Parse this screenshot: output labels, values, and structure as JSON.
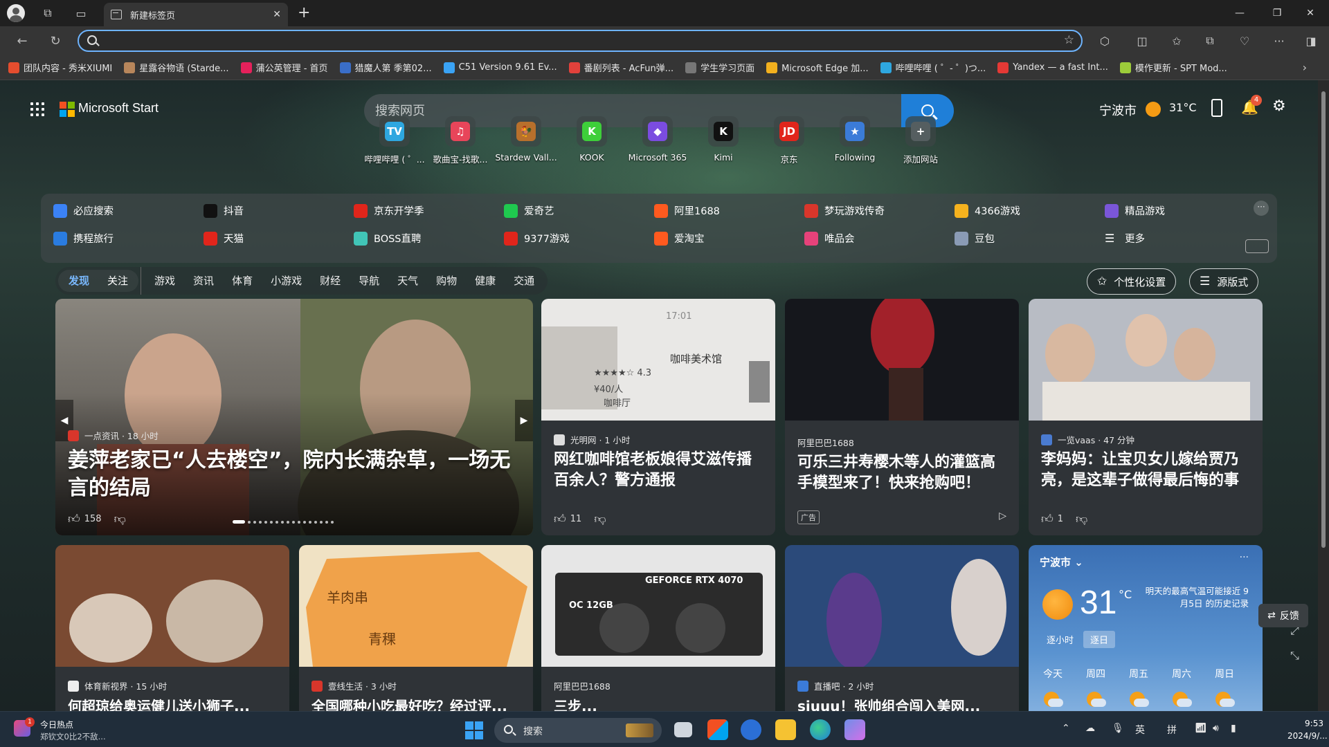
{
  "browser": {
    "tab_title": "新建标签页",
    "address_value": "",
    "favorites": [
      {
        "label": "团队内容 - 秀米XIUMI",
        "color": "#e54d2e"
      },
      {
        "label": "星露谷物语 (Starde...",
        "color": "#b8865b"
      },
      {
        "label": "蒲公英管理 - 首页",
        "color": "#e5215b"
      },
      {
        "label": "猎魔人第 季第02...",
        "color": "#3a6ec8"
      },
      {
        "label": "C51 Version 9.61 Ev...",
        "color": "#3aa3f5"
      },
      {
        "label": "番剧列表 - AcFun弹...",
        "color": "#e2413b"
      },
      {
        "label": "学生学习页面",
        "color": "#777777"
      },
      {
        "label": "Microsoft Edge 加...",
        "color": "#f2b01e"
      },
      {
        "label": "哔哩哔哩 ( ゜- ゜)つ...",
        "color": "#2ea7e0"
      },
      {
        "label": "Yandex — a fast Int...",
        "color": "#e53935"
      },
      {
        "label": "模作更新 - SPT Mod...",
        "color": "#9ccc3a"
      }
    ]
  },
  "header": {
    "brand": "Microsoft Start",
    "search_placeholder": "搜索网页",
    "city": "宁波市",
    "temp": "31°C",
    "notif_count": "4"
  },
  "quick_links": [
    {
      "label": "哔哩哔哩 ( ゜...",
      "glyph": "TV",
      "color": "#2ea7e0"
    },
    {
      "label": "歌曲宝-找歌...",
      "glyph": "♫",
      "color": "#e8455a"
    },
    {
      "label": "Stardew Vall...",
      "glyph": "🐓",
      "color": "#b8702c"
    },
    {
      "label": "KOOK",
      "glyph": "K",
      "color": "#3ecf3a"
    },
    {
      "label": "Microsoft 365",
      "glyph": "◆",
      "color": "#7b4ce0"
    },
    {
      "label": "Kimi",
      "glyph": "K",
      "color": "#111111"
    },
    {
      "label": "京东",
      "glyph": "JD",
      "color": "#e1251b"
    },
    {
      "label": "Following",
      "glyph": "★",
      "color": "#3b7bd8"
    },
    {
      "label": "添加网站",
      "glyph": "+",
      "color": "#555e60"
    }
  ],
  "link_panel": {
    "row1": [
      {
        "label": "必应搜索",
        "color": "#3b82f6"
      },
      {
        "label": "抖音",
        "color": "#111111"
      },
      {
        "label": "京东开学季",
        "color": "#e1251b"
      },
      {
        "label": "爱奇艺",
        "color": "#1fc94f"
      },
      {
        "label": "阿里1688",
        "color": "#ff5a1f"
      },
      {
        "label": "梦玩游戏传奇",
        "color": "#d9362b"
      },
      {
        "label": "4366游戏",
        "color": "#f5b21e"
      },
      {
        "label": "精品游戏",
        "color": "#7a56d8"
      }
    ],
    "row2": [
      {
        "label": "携程旅行",
        "color": "#2a7ce0"
      },
      {
        "label": "天猫",
        "color": "#e1251b"
      },
      {
        "label": "BOSS直聘",
        "color": "#41c5b7"
      },
      {
        "label": "9377游戏",
        "color": "#e1251b"
      },
      {
        "label": "爱淘宝",
        "color": "#ff5a1f"
      },
      {
        "label": "唯品会",
        "color": "#e6427a"
      },
      {
        "label": "豆包",
        "color": "#8a9bb5"
      },
      {
        "label": "更多",
        "color": "transparent"
      }
    ]
  },
  "nav": {
    "tabs": [
      "发现",
      "关注",
      "游戏",
      "资讯",
      "体育",
      "小游戏",
      "财经",
      "导航",
      "天气",
      "购物",
      "健康",
      "交通"
    ],
    "personalize": "个性化设置",
    "layout": "源版式"
  },
  "cards": {
    "hero": {
      "source": "一点资讯 · 18 小时",
      "title": "姜萍老家已“人去楼空”，院内长满杂草，一场无言的结局",
      "likes": "158"
    },
    "c2": {
      "source": "光明网 · 1 小时",
      "title": "网红咖啡馆老板娘得艾滋传播百余人？警方通报",
      "likes": "11",
      "img_time": "17:01",
      "img_shop": "咖啡美术馆",
      "img_rating": "★★★★☆ 4.3",
      "img_price": "¥40/人",
      "img_type": "咖啡厅"
    },
    "c3": {
      "source": "阿里巴巴1688",
      "title": "可乐三井寿樱木等人的灌篮高手模型来了！快来抢购吧！",
      "ad": "广告"
    },
    "c4": {
      "source": "一览vaas · 47 分钟",
      "title": "李妈妈：让宝贝女儿嫁给贾乃亮，是这辈子做得最后悔的事",
      "likes": "1"
    },
    "r2c1": {
      "source": "体育新视界 · 15 小时",
      "title": "何超琼给奥运健儿送小狮子..."
    },
    "r2c2": {
      "source": "壹线生活 · 3 小时",
      "title": "全国哪种小吃最好吃？经过评...",
      "map1": "羊肉串",
      "map2": "青稞"
    },
    "r2c3": {
      "source": "阿里巴巴1688",
      "title": "三步...",
      "gpu": "GEFORCE RTX 4070",
      "gpu2": "OC 12GB"
    },
    "r2c4": {
      "source": "直播吧 · 2 小时",
      "title": "siuuu！张帅组合闯入美网..."
    }
  },
  "weather": {
    "city": "宁波市",
    "temp": "31",
    "unit": "°C",
    "note": "明天的最高气温可能接近 9月5日 的历史记录",
    "tab_hourly": "逐小时",
    "tab_daily": "逐日",
    "days": [
      "今天",
      "周四",
      "周五",
      "周六",
      "周日"
    ]
  },
  "feedback": "反馈",
  "taskbar": {
    "news_title": "今日热点",
    "news_sub": "郑钦文0比2不敌...",
    "news_badge": "1",
    "search": "搜索",
    "ime1": "英",
    "ime2": "拼",
    "time": "9:53",
    "date": "2024/9/..."
  }
}
